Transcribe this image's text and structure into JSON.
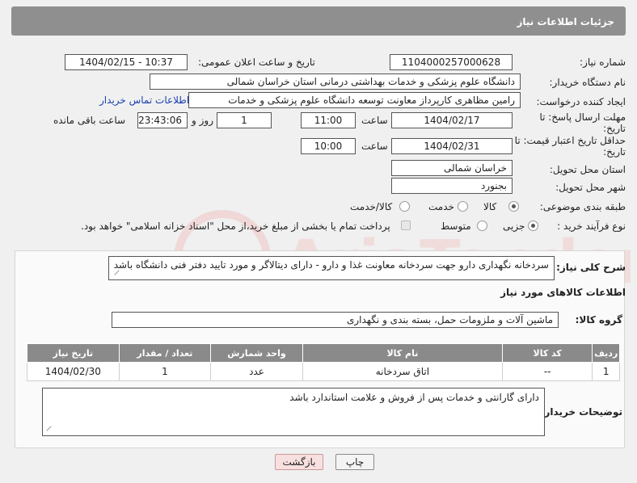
{
  "header": {
    "title": "جزئیات اطلاعات نیاز"
  },
  "fields": {
    "need_number": {
      "label": "شماره نیاز:",
      "value": "1104000257000628"
    },
    "announce_datetime": {
      "label": "تاریخ و ساعت اعلان عمومی:",
      "value": "1404/02/15 - 10:37"
    },
    "buyer_org": {
      "label": "نام دستگاه خریدار:",
      "value": "دانشگاه علوم پزشکی و خدمات بهداشتی درمانی استان خراسان شمالی"
    },
    "creator": {
      "label": "ایجاد کننده درخواست:",
      "value": "رامین مظاهری کارپرداز معاونت توسعه دانشگاه علوم پزشکی و خدمات",
      "contact_link": "اطلاعات تماس خریدار"
    },
    "reply_deadline": {
      "label": "مهلت ارسال پاسخ: تا تاریخ:",
      "date": "1404/02/17",
      "time_label": "ساعت",
      "time": "11:00",
      "days": "1",
      "days_label": "روز و",
      "remaining": "23:43:06",
      "remaining_label": "ساعت باقی مانده"
    },
    "price_validity": {
      "label": "حداقل تاریخ اعتبار قیمت: تا تاریخ:",
      "date": "1404/02/31",
      "time_label": "ساعت",
      "time": "10:00"
    },
    "delivery_province": {
      "label": "استان محل تحویل:",
      "value": "خراسان شمالی"
    },
    "delivery_city": {
      "label": "شهر محل تحویل:",
      "value": "بجنورد"
    },
    "category": {
      "label": "طبقه بندی موضوعی:",
      "options": [
        "کالا",
        "خدمت",
        "کالا/خدمت"
      ],
      "selected": "کالا"
    },
    "process_type": {
      "label": "نوع فرآیند خرید :",
      "options": [
        "جزیی",
        "متوسط"
      ],
      "selected": "جزیی",
      "payment_note": "پرداخت تمام یا بخشی از مبلغ خرید،از محل \"اسناد خزانه اسلامی\" خواهد بود."
    }
  },
  "description": {
    "label": "شرح کلی نیاز:",
    "value": "سردخانه نگهداری دارو جهت سردخانه معاونت غذا و دارو - دارای دیتالاگر و مورد تایید دفتر فنی دانشگاه باشد"
  },
  "goods_section": {
    "title": "اطلاعات کالاهای مورد نیاز",
    "group_label": "گروه کالا:",
    "group_value": "ماشین آلات و ملزومات حمل، بسته بندی و نگهداری"
  },
  "table": {
    "headers": [
      "ردیف",
      "کد کالا",
      "نام کالا",
      "واحد شمارش",
      "تعداد / مقدار",
      "تاریخ نیاز"
    ],
    "rows": [
      [
        "1",
        "--",
        "اتاق سردخانه",
        "عدد",
        "1",
        "1404/02/30"
      ]
    ]
  },
  "buyer_notes": {
    "label": "توضیحات خریدار:",
    "value": "دارای گارانتی و خدمات پس از فروش و علامت استاندارد باشد"
  },
  "buttons": {
    "print": "چاپ",
    "back": "بازگشت"
  },
  "watermark": {
    "text": "AriaTender.neT"
  }
}
